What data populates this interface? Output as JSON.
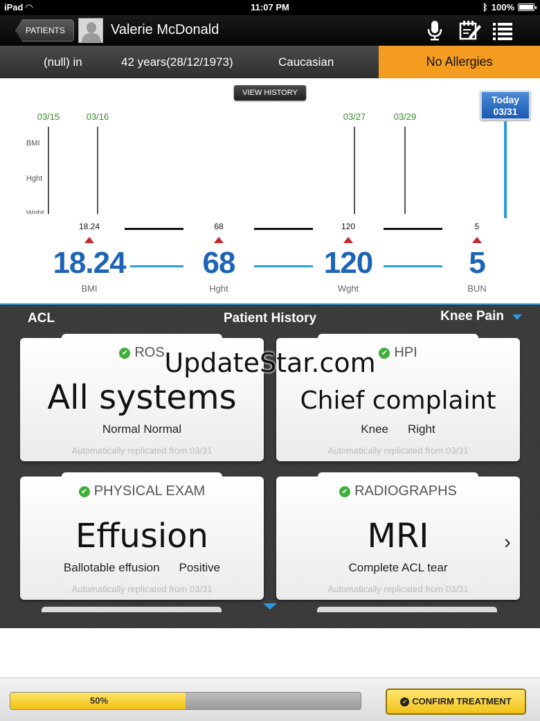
{
  "status_bar": {
    "device": "iPad",
    "time": "11:07 PM",
    "battery": "100%"
  },
  "header": {
    "back_label": "PATIENTS",
    "patient_name": "Valerie McDonald",
    "icons": [
      "microphone-icon",
      "edit-note-icon",
      "list-icon"
    ]
  },
  "info_bar": {
    "height": "(null) in",
    "age": "42 years(28/12/1973)",
    "ethnicity": "Caucasian",
    "allergies": "No Allergies"
  },
  "timeline": {
    "view_history": "VIEW HISTORY",
    "dates": [
      "03/15",
      "03/16",
      "03/27",
      "03/29"
    ],
    "row_labels": [
      "BMI",
      "Hght",
      "Wght"
    ],
    "today_label": "Today",
    "today_date": "03/31"
  },
  "metrics": [
    {
      "small": "18.24",
      "big": "18.24",
      "caption": "BMI"
    },
    {
      "small": "68",
      "big": "68",
      "caption": "Hght"
    },
    {
      "small": "120",
      "big": "120",
      "caption": "Wght"
    },
    {
      "small": "5",
      "big": "5",
      "caption": "BUN"
    }
  ],
  "history": {
    "left": "ACL",
    "title": "Patient History",
    "right": "Knee Pain",
    "cards": [
      {
        "head": "ROS",
        "big": "All systems",
        "subs": [
          "Normal Normal"
        ],
        "foot": "Automatically replicated from 03/31"
      },
      {
        "head": "HPI",
        "big": "Chief complaint",
        "subs": [
          "Knee",
          "Right"
        ],
        "foot": "Automatically replicated from 03/31"
      },
      {
        "head": "PHYSICAL EXAM",
        "big": "Effusion",
        "subs": [
          "Ballotable effusion",
          "Positive"
        ],
        "foot": "Automatically replicated from 03/31"
      },
      {
        "head": "RADIOGRAPHS",
        "big": "MRI",
        "subs": [
          "Complete ACL tear"
        ],
        "foot": "Automatically replicated from 03/31"
      }
    ],
    "next_arrow": "›"
  },
  "footer": {
    "progress_percent": 50,
    "progress_text": "50%",
    "confirm_label": "CONFIRM TREATMENT"
  },
  "watermark": "UpdateStar.com",
  "colors": {
    "accent_blue": "#2b9ae0",
    "allergy_orange": "#f39c1f",
    "metric_blue": "#1d64b8",
    "check_green": "#3fae3a"
  }
}
